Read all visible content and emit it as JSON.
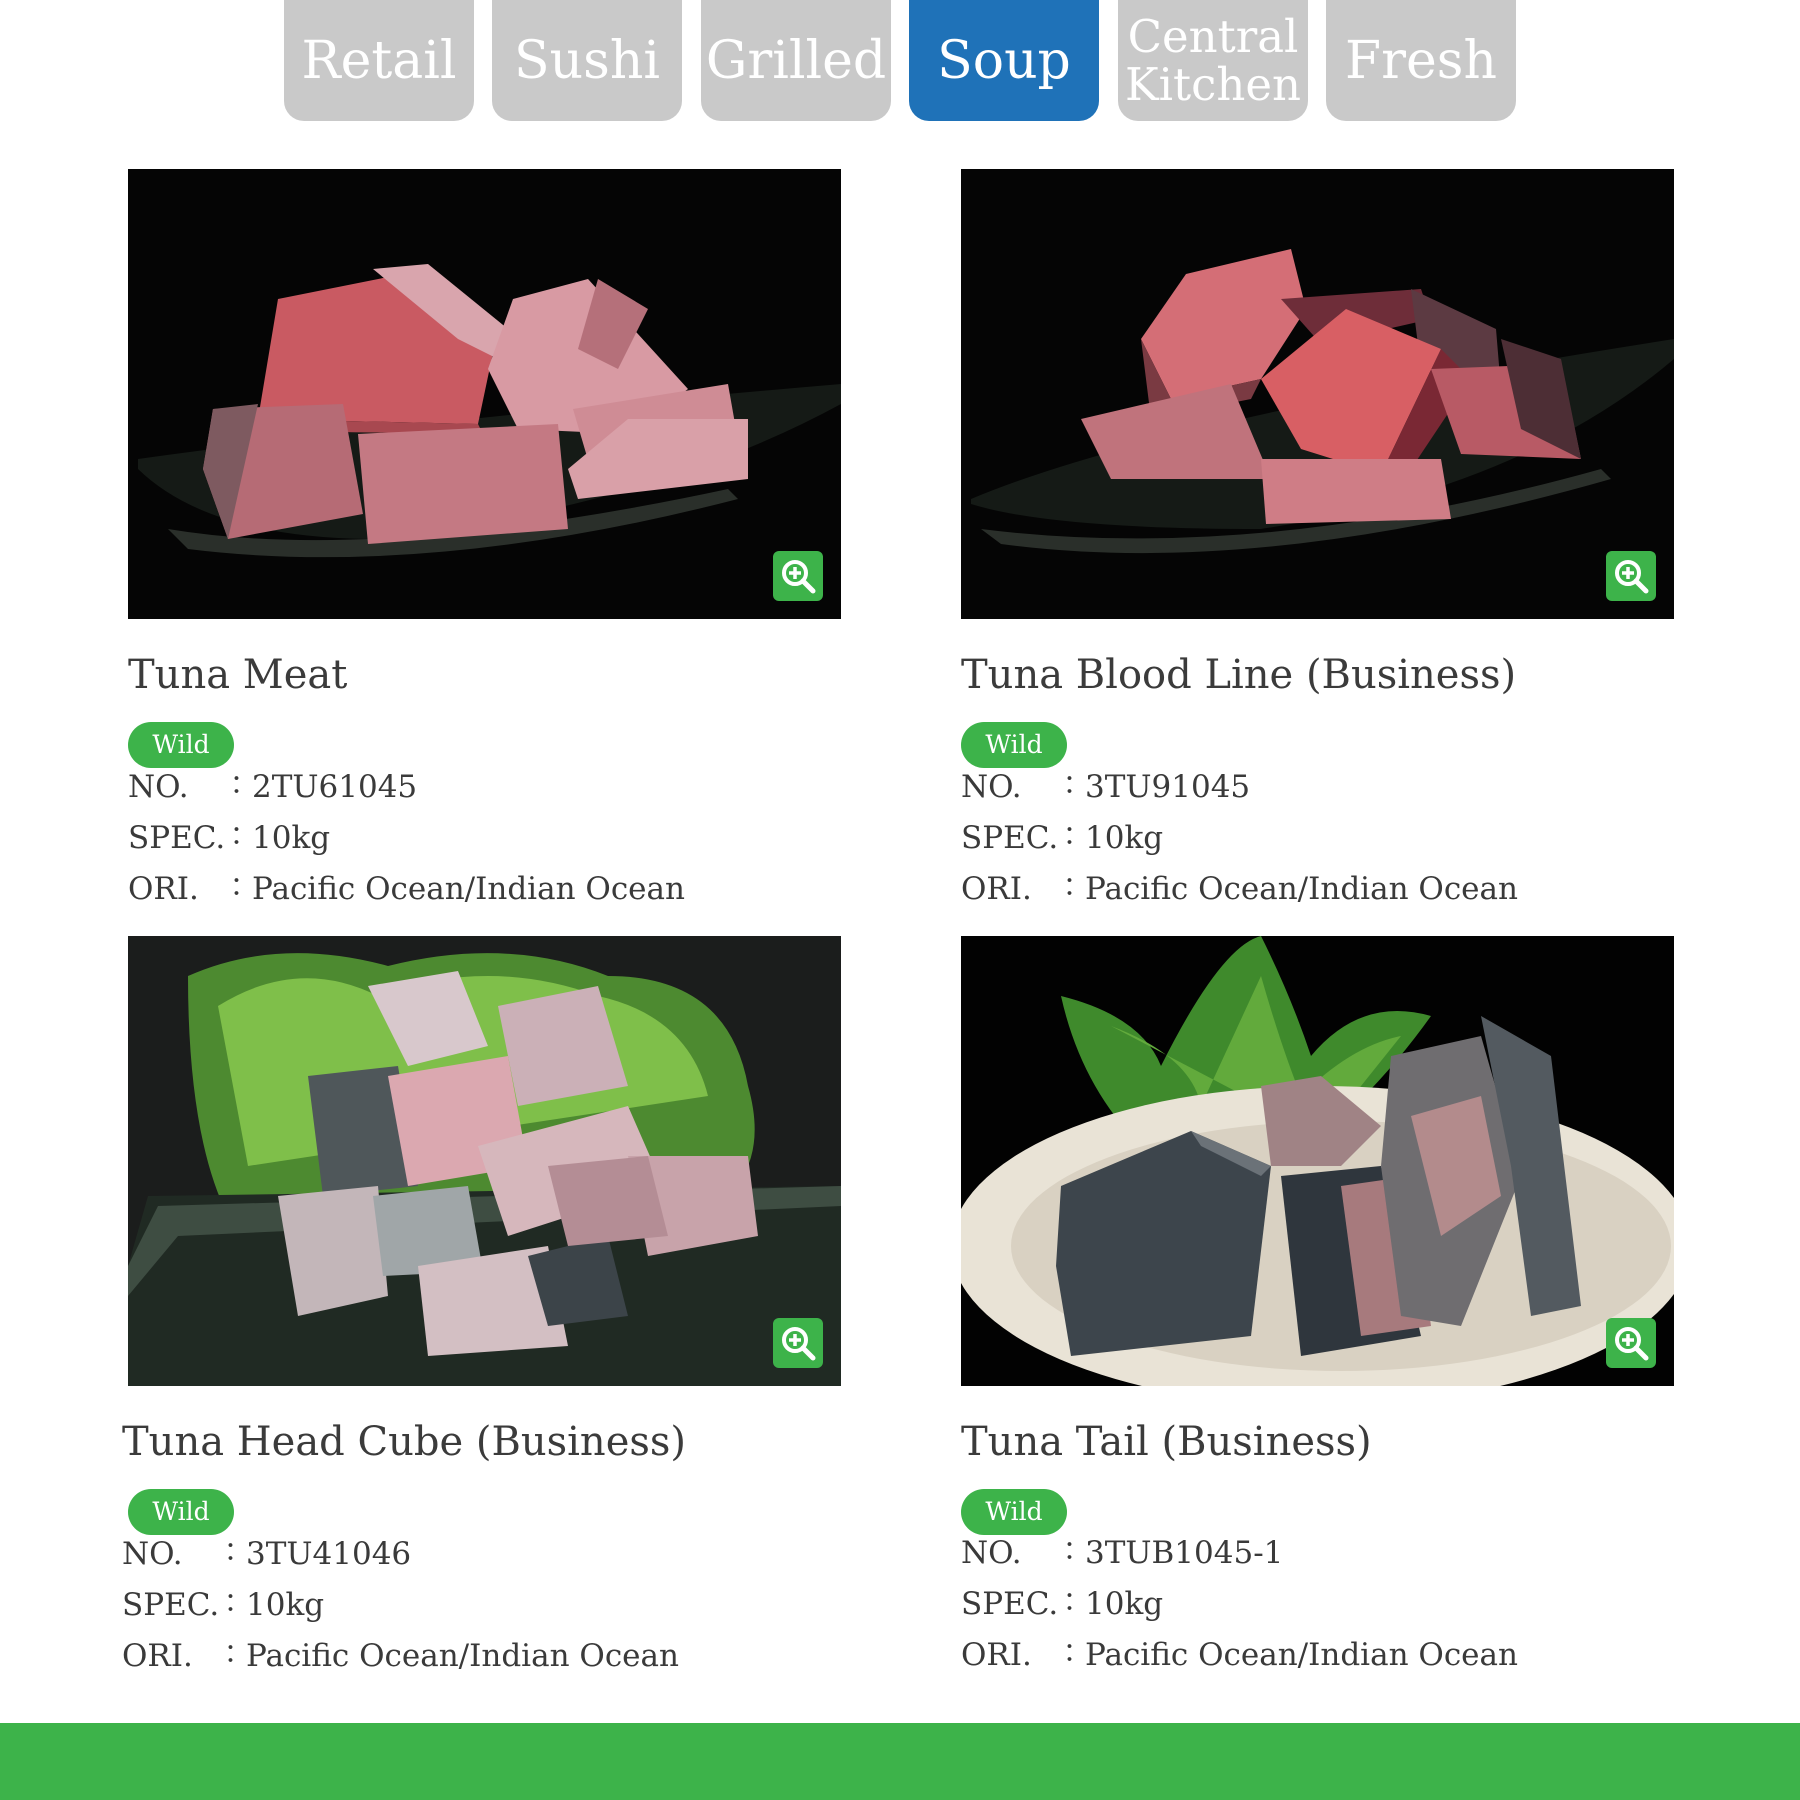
{
  "tabs": [
    {
      "label": "Retail",
      "active": false
    },
    {
      "label": "Sushi",
      "active": false
    },
    {
      "label": "Grilled",
      "active": false
    },
    {
      "label": "Soup",
      "active": true
    },
    {
      "label": "Central\nKitchen",
      "active": false
    },
    {
      "label": "Fresh",
      "active": false
    }
  ],
  "products": [
    {
      "name": "Tuna Meat",
      "badge": "Wild",
      "no_label": "NO.",
      "no_value": "2TU61045",
      "spec_label": "SPEC.",
      "spec_value": "10kg",
      "ori_label": "ORI.",
      "ori_value": "Pacific Ocean/Indian Ocean",
      "colon": "："
    },
    {
      "name": "Tuna Blood Line (Business)",
      "badge": "Wild",
      "no_label": "NO.",
      "no_value": "3TU91045",
      "spec_label": "SPEC.",
      "spec_value": "10kg",
      "ori_label": "ORI.",
      "ori_value": "Pacific Ocean/Indian Ocean",
      "colon": "："
    },
    {
      "name": "Tuna Head Cube (Business)",
      "badge": "Wild",
      "no_label": "NO.",
      "no_value": "3TU41046",
      "spec_label": "SPEC.",
      "spec_value": "10kg",
      "ori_label": "ORI.",
      "ori_value": "Pacific Ocean/Indian Ocean",
      "colon": "："
    },
    {
      "name": "Tuna Tail (Business)",
      "badge": "Wild",
      "no_label": "NO.",
      "no_value": "3TUB1045-1",
      "spec_label": "SPEC.",
      "spec_value": "10kg",
      "ori_label": "ORI.",
      "ori_value": "Pacific Ocean/Indian Ocean",
      "colon": "："
    }
  ],
  "colors": {
    "tab_inactive": "#c9c9c9",
    "tab_active": "#1f72b8",
    "badge": "#3db34a",
    "footer": "#3db34a",
    "zoom_button": "#3db34a"
  },
  "icons": {
    "zoom": "zoom-in-icon"
  }
}
